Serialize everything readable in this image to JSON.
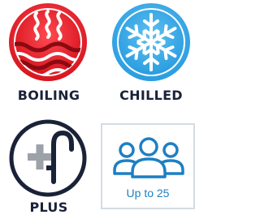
{
  "tiles": {
    "boiling": {
      "label": "BOILING",
      "icon": "steam-waves-icon",
      "color": "#e42230"
    },
    "chilled": {
      "label": "CHILLED",
      "icon": "snowflake-icon",
      "color": "#2a9de0"
    },
    "plus": {
      "label": "PLUS",
      "icon": "plus-tap-icon",
      "color": "#1a2238"
    },
    "capacity": {
      "caption": "Up to 25",
      "icon": "people-group-icon",
      "color": "#1d7fc4"
    }
  }
}
